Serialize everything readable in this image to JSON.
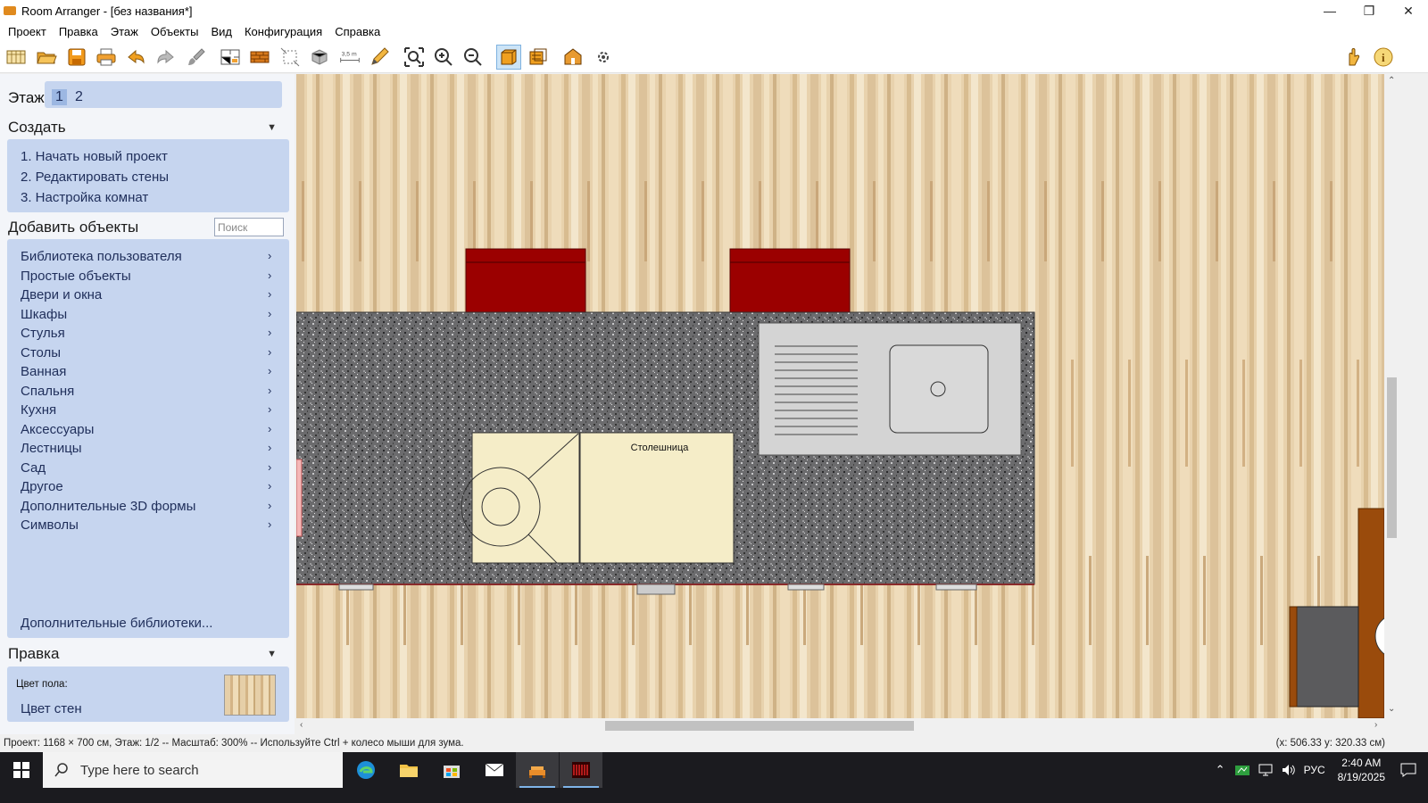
{
  "window": {
    "title": "Room Arranger - [без названия*]"
  },
  "menu": [
    "Проект",
    "Правка",
    "Этаж",
    "Объекты",
    "Вид",
    "Конфигурация",
    "Справка"
  ],
  "toolbar": {
    "measure_label": "3,5 m"
  },
  "floor": {
    "label": "Этаж",
    "tabs": [
      "1",
      "2"
    ],
    "selected": "1"
  },
  "create": {
    "title": "Создать",
    "items": [
      "1. Начать новый проект",
      "2. Редактировать стены",
      "3. Настройка комнат"
    ]
  },
  "add_objects": {
    "title": "Добавить объекты",
    "search_placeholder": "Поиск",
    "items": [
      "Библиотека пользователя",
      "Простые объекты",
      "Двери и окна",
      "Шкафы",
      "Стулья",
      "Столы",
      "Ванная",
      "Спальня",
      "Кухня",
      "Аксессуары",
      "Лестницы",
      "Сад",
      "Другое",
      "Дополнительные 3D формы",
      "Символы"
    ],
    "more_link": "Дополнительные библиотеки..."
  },
  "edit": {
    "title": "Правка",
    "floor_color_label": "Цвет пола:",
    "wall_color_label": "Цвет стен"
  },
  "canvas": {
    "countertop_label": "Столешница"
  },
  "status": {
    "text": "Проект: 1168 × 700 см, Этаж: 1/2 -- Масштаб: 300% -- Используйте Ctrl + колесо мыши для зума.",
    "coords": "(x: 506.33 y: 320.33 см)"
  },
  "taskbar": {
    "search_placeholder": "Type here to search",
    "lang": "РУС",
    "time": "2:40 AM",
    "date": "8/19/2025"
  },
  "colors": {
    "panel": "#c6d5ef",
    "accent": "#1f2e5a",
    "chair": "#9b0000",
    "cabinet": "#f5edc8"
  }
}
